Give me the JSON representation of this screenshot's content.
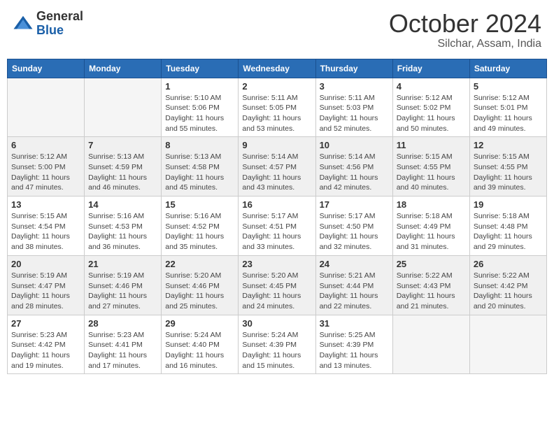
{
  "header": {
    "logo_general": "General",
    "logo_blue": "Blue",
    "title_month": "October 2024",
    "title_location": "Silchar, Assam, India"
  },
  "days_of_week": [
    "Sunday",
    "Monday",
    "Tuesday",
    "Wednesday",
    "Thursday",
    "Friday",
    "Saturday"
  ],
  "weeks": [
    [
      {
        "day": "",
        "sunrise": "",
        "sunset": "",
        "daylight": ""
      },
      {
        "day": "",
        "sunrise": "",
        "sunset": "",
        "daylight": ""
      },
      {
        "day": "1",
        "sunrise": "Sunrise: 5:10 AM",
        "sunset": "Sunset: 5:06 PM",
        "daylight": "Daylight: 11 hours and 55 minutes."
      },
      {
        "day": "2",
        "sunrise": "Sunrise: 5:11 AM",
        "sunset": "Sunset: 5:05 PM",
        "daylight": "Daylight: 11 hours and 53 minutes."
      },
      {
        "day": "3",
        "sunrise": "Sunrise: 5:11 AM",
        "sunset": "Sunset: 5:03 PM",
        "daylight": "Daylight: 11 hours and 52 minutes."
      },
      {
        "day": "4",
        "sunrise": "Sunrise: 5:12 AM",
        "sunset": "Sunset: 5:02 PM",
        "daylight": "Daylight: 11 hours and 50 minutes."
      },
      {
        "day": "5",
        "sunrise": "Sunrise: 5:12 AM",
        "sunset": "Sunset: 5:01 PM",
        "daylight": "Daylight: 11 hours and 49 minutes."
      }
    ],
    [
      {
        "day": "6",
        "sunrise": "Sunrise: 5:12 AM",
        "sunset": "Sunset: 5:00 PM",
        "daylight": "Daylight: 11 hours and 47 minutes."
      },
      {
        "day": "7",
        "sunrise": "Sunrise: 5:13 AM",
        "sunset": "Sunset: 4:59 PM",
        "daylight": "Daylight: 11 hours and 46 minutes."
      },
      {
        "day": "8",
        "sunrise": "Sunrise: 5:13 AM",
        "sunset": "Sunset: 4:58 PM",
        "daylight": "Daylight: 11 hours and 45 minutes."
      },
      {
        "day": "9",
        "sunrise": "Sunrise: 5:14 AM",
        "sunset": "Sunset: 4:57 PM",
        "daylight": "Daylight: 11 hours and 43 minutes."
      },
      {
        "day": "10",
        "sunrise": "Sunrise: 5:14 AM",
        "sunset": "Sunset: 4:56 PM",
        "daylight": "Daylight: 11 hours and 42 minutes."
      },
      {
        "day": "11",
        "sunrise": "Sunrise: 5:15 AM",
        "sunset": "Sunset: 4:55 PM",
        "daylight": "Daylight: 11 hours and 40 minutes."
      },
      {
        "day": "12",
        "sunrise": "Sunrise: 5:15 AM",
        "sunset": "Sunset: 4:55 PM",
        "daylight": "Daylight: 11 hours and 39 minutes."
      }
    ],
    [
      {
        "day": "13",
        "sunrise": "Sunrise: 5:15 AM",
        "sunset": "Sunset: 4:54 PM",
        "daylight": "Daylight: 11 hours and 38 minutes."
      },
      {
        "day": "14",
        "sunrise": "Sunrise: 5:16 AM",
        "sunset": "Sunset: 4:53 PM",
        "daylight": "Daylight: 11 hours and 36 minutes."
      },
      {
        "day": "15",
        "sunrise": "Sunrise: 5:16 AM",
        "sunset": "Sunset: 4:52 PM",
        "daylight": "Daylight: 11 hours and 35 minutes."
      },
      {
        "day": "16",
        "sunrise": "Sunrise: 5:17 AM",
        "sunset": "Sunset: 4:51 PM",
        "daylight": "Daylight: 11 hours and 33 minutes."
      },
      {
        "day": "17",
        "sunrise": "Sunrise: 5:17 AM",
        "sunset": "Sunset: 4:50 PM",
        "daylight": "Daylight: 11 hours and 32 minutes."
      },
      {
        "day": "18",
        "sunrise": "Sunrise: 5:18 AM",
        "sunset": "Sunset: 4:49 PM",
        "daylight": "Daylight: 11 hours and 31 minutes."
      },
      {
        "day": "19",
        "sunrise": "Sunrise: 5:18 AM",
        "sunset": "Sunset: 4:48 PM",
        "daylight": "Daylight: 11 hours and 29 minutes."
      }
    ],
    [
      {
        "day": "20",
        "sunrise": "Sunrise: 5:19 AM",
        "sunset": "Sunset: 4:47 PM",
        "daylight": "Daylight: 11 hours and 28 minutes."
      },
      {
        "day": "21",
        "sunrise": "Sunrise: 5:19 AM",
        "sunset": "Sunset: 4:46 PM",
        "daylight": "Daylight: 11 hours and 27 minutes."
      },
      {
        "day": "22",
        "sunrise": "Sunrise: 5:20 AM",
        "sunset": "Sunset: 4:46 PM",
        "daylight": "Daylight: 11 hours and 25 minutes."
      },
      {
        "day": "23",
        "sunrise": "Sunrise: 5:20 AM",
        "sunset": "Sunset: 4:45 PM",
        "daylight": "Daylight: 11 hours and 24 minutes."
      },
      {
        "day": "24",
        "sunrise": "Sunrise: 5:21 AM",
        "sunset": "Sunset: 4:44 PM",
        "daylight": "Daylight: 11 hours and 22 minutes."
      },
      {
        "day": "25",
        "sunrise": "Sunrise: 5:22 AM",
        "sunset": "Sunset: 4:43 PM",
        "daylight": "Daylight: 11 hours and 21 minutes."
      },
      {
        "day": "26",
        "sunrise": "Sunrise: 5:22 AM",
        "sunset": "Sunset: 4:42 PM",
        "daylight": "Daylight: 11 hours and 20 minutes."
      }
    ],
    [
      {
        "day": "27",
        "sunrise": "Sunrise: 5:23 AM",
        "sunset": "Sunset: 4:42 PM",
        "daylight": "Daylight: 11 hours and 19 minutes."
      },
      {
        "day": "28",
        "sunrise": "Sunrise: 5:23 AM",
        "sunset": "Sunset: 4:41 PM",
        "daylight": "Daylight: 11 hours and 17 minutes."
      },
      {
        "day": "29",
        "sunrise": "Sunrise: 5:24 AM",
        "sunset": "Sunset: 4:40 PM",
        "daylight": "Daylight: 11 hours and 16 minutes."
      },
      {
        "day": "30",
        "sunrise": "Sunrise: 5:24 AM",
        "sunset": "Sunset: 4:39 PM",
        "daylight": "Daylight: 11 hours and 15 minutes."
      },
      {
        "day": "31",
        "sunrise": "Sunrise: 5:25 AM",
        "sunset": "Sunset: 4:39 PM",
        "daylight": "Daylight: 11 hours and 13 minutes."
      },
      {
        "day": "",
        "sunrise": "",
        "sunset": "",
        "daylight": ""
      },
      {
        "day": "",
        "sunrise": "",
        "sunset": "",
        "daylight": ""
      }
    ]
  ]
}
